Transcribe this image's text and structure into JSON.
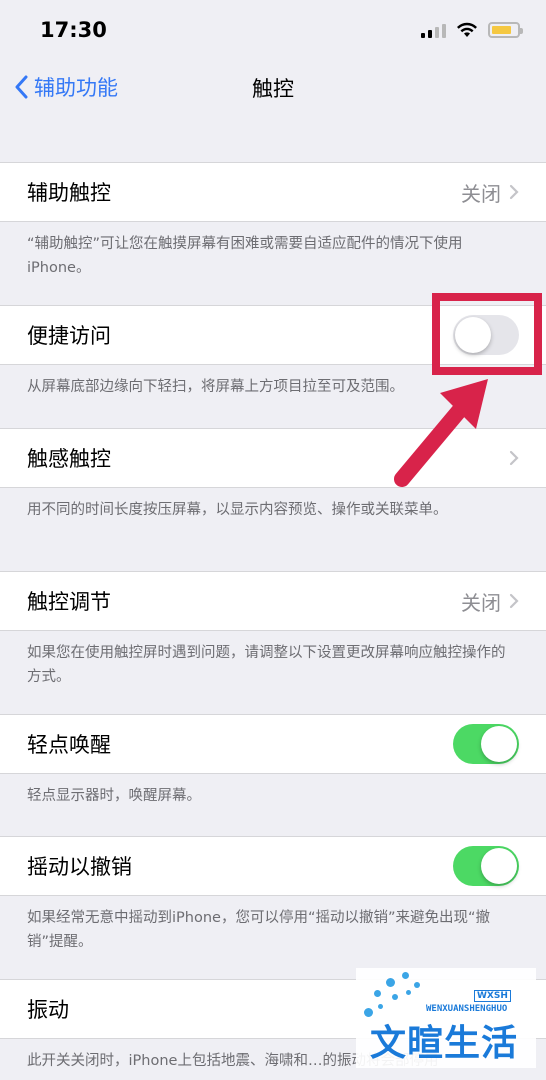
{
  "status_bar": {
    "time": "17:30"
  },
  "nav": {
    "back_label": "辅助功能",
    "title": "触控"
  },
  "sections": {
    "assistive_touch": {
      "label": "辅助触控",
      "value": "关闭",
      "footer": "“辅助触控”可让您在触摸屏幕有困难或需要自适应配件的情况下使用iPhone。"
    },
    "reachability": {
      "label": "便捷访问",
      "state": "off",
      "footer": "从屏幕底部边缘向下轻扫，将屏幕上方项目拉至可及范围。"
    },
    "haptic_touch": {
      "label": "触感触控",
      "footer": "用不同的时间长度按压屏幕，以显示内容预览、操作或关联菜单。"
    },
    "touch_accommodations": {
      "label": "触控调节",
      "value": "关闭",
      "footer": "如果您在使用触控屏时遇到问题，请调整以下设置更改屏幕响应触控操作的方式。"
    },
    "tap_to_wake": {
      "label": "轻点唤醒",
      "state": "on",
      "footer": "轻点显示器时，唤醒屏幕。"
    },
    "shake_to_undo": {
      "label": "摇动以撤销",
      "state": "on",
      "footer": "如果经常无意中摇动到iPhone，您可以停用“摇动以撤销”来避免出现“撤销”提醒。"
    },
    "vibration": {
      "label": "振动",
      "footer": "此开关关闭时，iPhone上包括地震、海啸和…的振动将会部停用"
    }
  },
  "watermark": {
    "latin": "WENXUANSHENGHUO",
    "cn": "文暄生活",
    "badge": "WXSH"
  },
  "colors": {
    "accent": "#3478f6",
    "toggle_on": "#4cd964",
    "highlight": "#d8234a"
  }
}
